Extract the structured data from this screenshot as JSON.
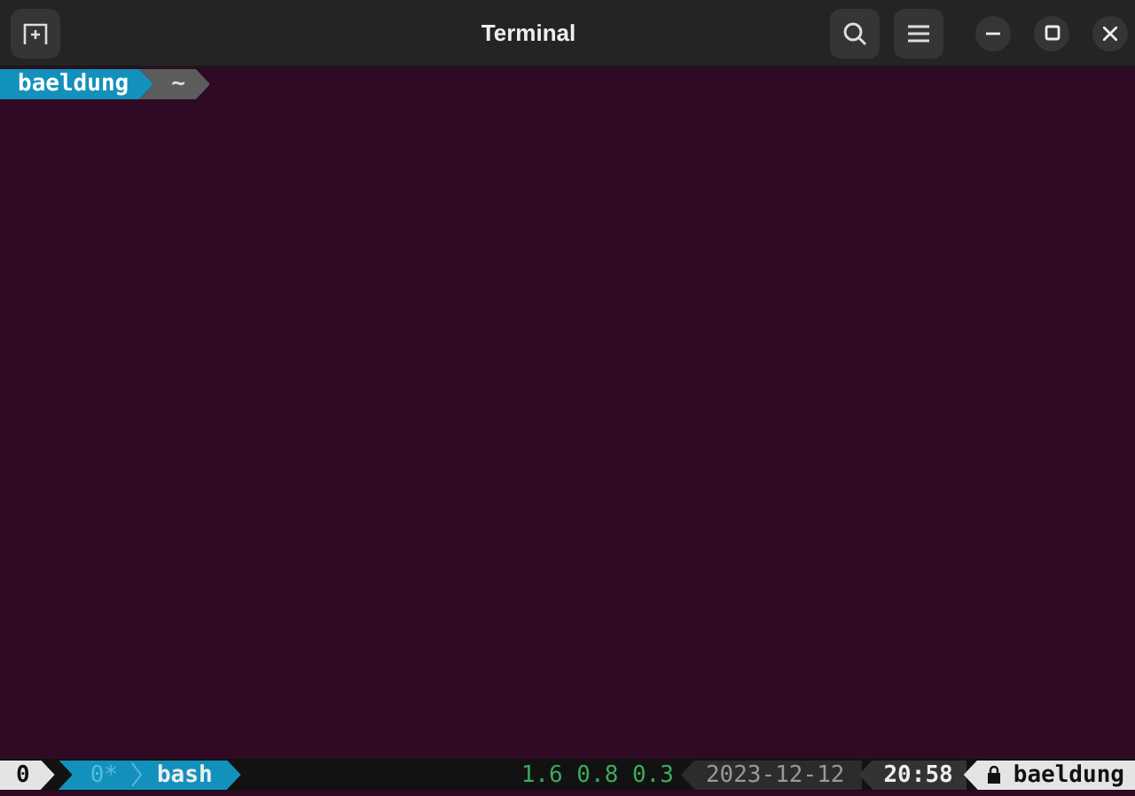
{
  "window": {
    "title": "Terminal"
  },
  "prompt": {
    "user": "baeldung",
    "path": "~"
  },
  "status_bar": {
    "session": "0",
    "windows": [
      {
        "index": "0*",
        "name": "bash",
        "selected": true
      }
    ],
    "load": "1.6 0.8 0.3",
    "date": "2023-12-12",
    "time": "20:58",
    "host": "baeldung"
  }
}
